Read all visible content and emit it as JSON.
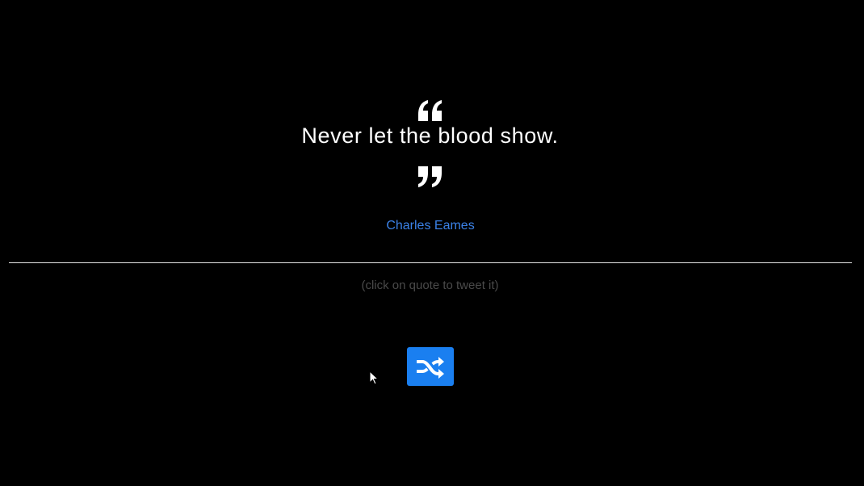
{
  "quote": {
    "text": "Never let the blood show.",
    "author": "Charles Eames",
    "open_icon": "quote-left-icon",
    "close_icon": "quote-right-icon"
  },
  "hint": "(click on quote to tweet it)",
  "shuffle_button": {
    "icon": "shuffle-icon",
    "color": "#1a7ff0"
  },
  "colors": {
    "background": "#000000",
    "quote_text": "#ffffff",
    "author_link": "#3b82e8",
    "hint_text": "#4a4a4a"
  }
}
